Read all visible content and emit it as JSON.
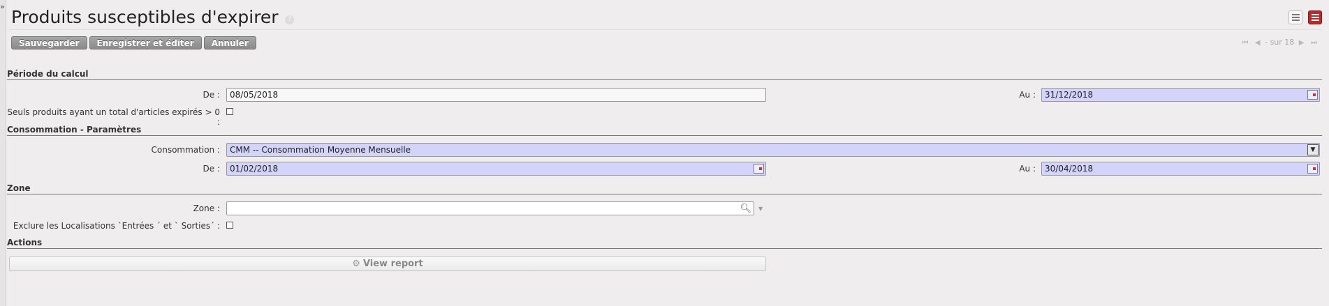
{
  "sidebar": {
    "toggle": "»"
  },
  "header": {
    "title": "Produits susceptibles d'expirer",
    "help": "?"
  },
  "toolbar": {
    "save": "Sauvegarder",
    "save_edit": "Enregistrer et éditer",
    "cancel": "Annuler"
  },
  "pager": {
    "text": "- sur 18",
    "first": "⏮",
    "prev": "◀",
    "next": "▶",
    "last": "⏭"
  },
  "sections": {
    "period": "Période du calcul",
    "consumption": "Consommation - Paramètres",
    "zone": "Zone",
    "actions": "Actions"
  },
  "period": {
    "from_label": "De :",
    "from_value": "08/05/2018",
    "to_label": "Au :",
    "to_value": "31/12/2018",
    "only_expired_label": "Seuls produits ayant un total d'articles expirés > 0 :"
  },
  "consumption": {
    "type_label": "Consommation :",
    "type_value": "CMM -- Consommation Moyenne Mensuelle",
    "from_label": "De :",
    "from_value": "01/02/2018",
    "to_label": "Au :",
    "to_value": "30/04/2018"
  },
  "zone": {
    "zone_label": "Zone :",
    "zone_value": "",
    "exclude_label": "Exclure les Localisations `Entrées ´ et ` Sorties´ :"
  },
  "actions": {
    "view_report": "View report"
  },
  "colors": {
    "required_field": "#d4d4fb",
    "accent": "#b92a2a"
  }
}
